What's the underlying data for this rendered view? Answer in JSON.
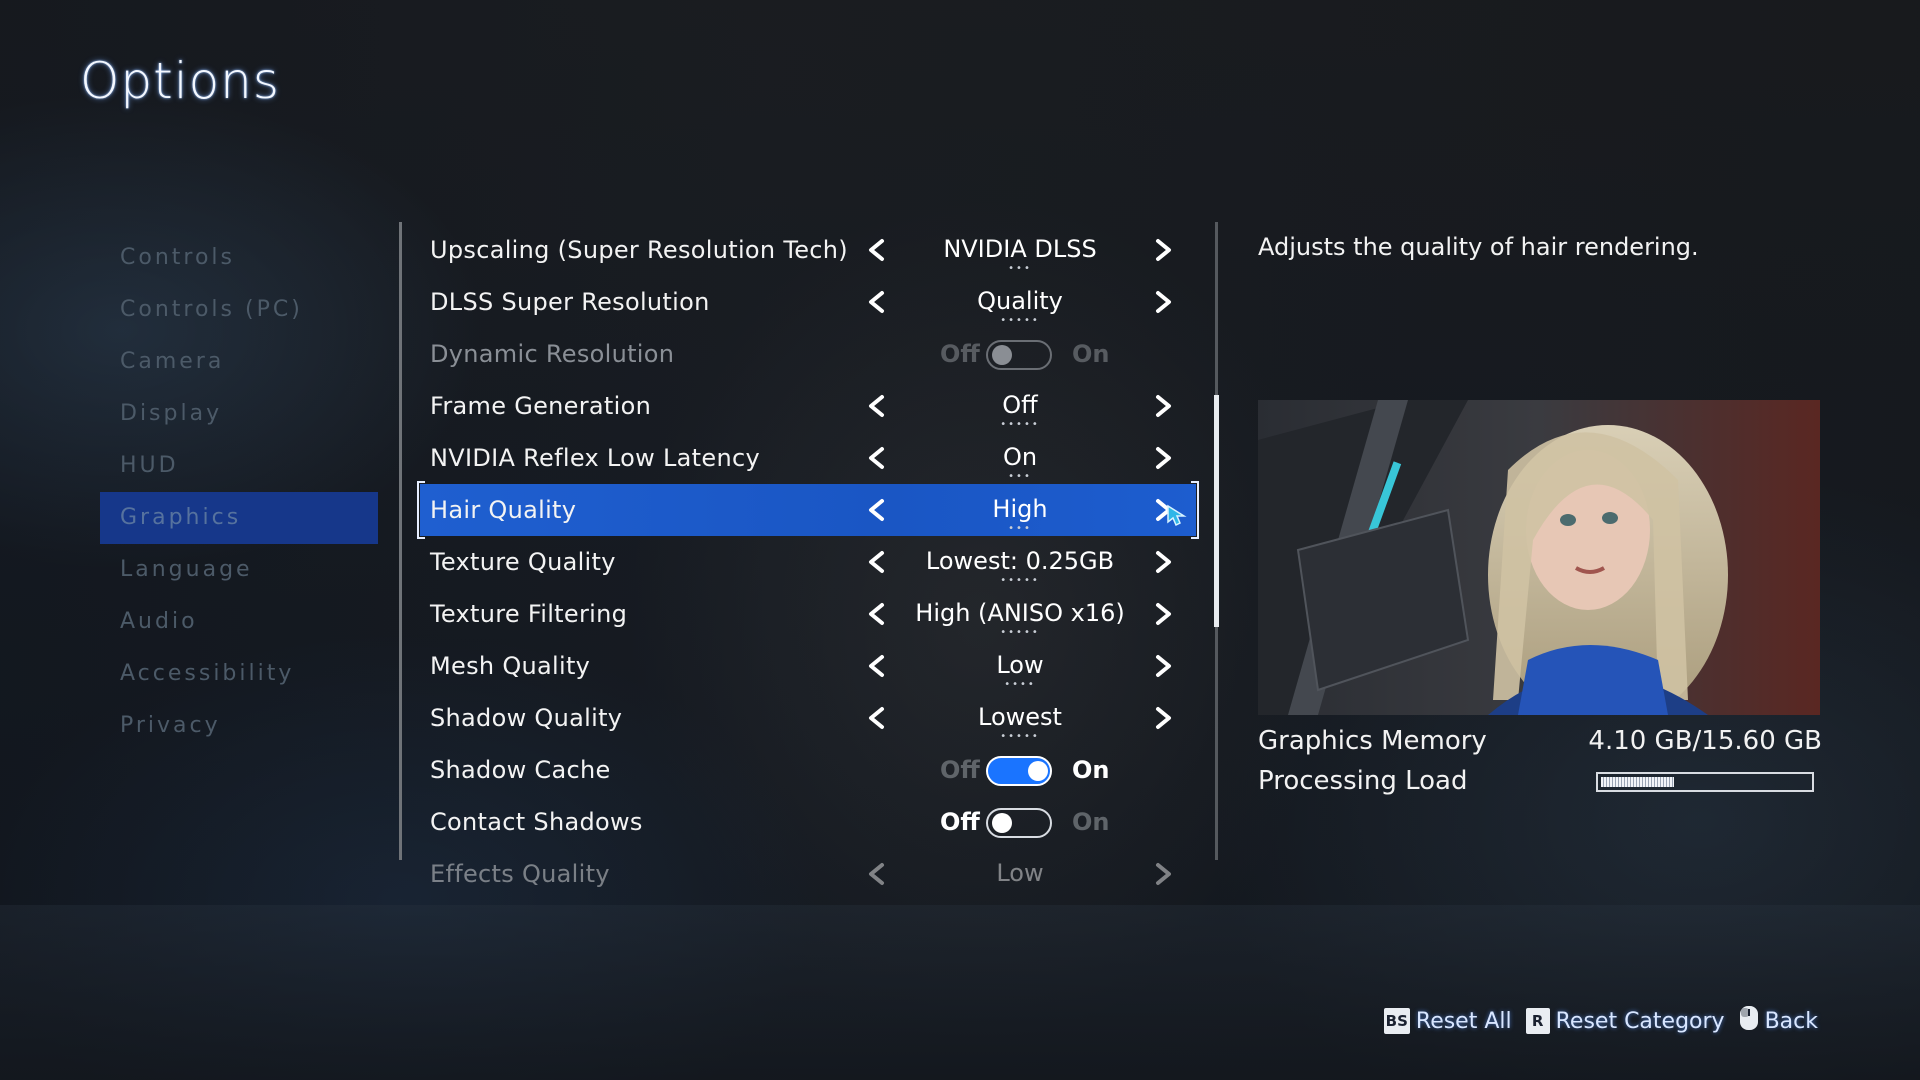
{
  "title": "Options",
  "categories": [
    {
      "label": "Controls"
    },
    {
      "label": "Controls (PC)"
    },
    {
      "label": "Camera"
    },
    {
      "label": "Display"
    },
    {
      "label": "HUD"
    },
    {
      "label": "Graphics",
      "active": true
    },
    {
      "label": "Language"
    },
    {
      "label": "Audio"
    },
    {
      "label": "Accessibility"
    },
    {
      "label": "Privacy"
    }
  ],
  "settings": [
    {
      "label": "Upscaling (Super Resolution Tech)",
      "type": "select",
      "value": "NVIDIA DLSS",
      "option_count": 3
    },
    {
      "label": "DLSS Super Resolution",
      "type": "select",
      "value": "Quality",
      "option_count": 5
    },
    {
      "label": "Dynamic Resolution",
      "type": "toggle",
      "off_label": "Off",
      "on_label": "On",
      "state": "off",
      "disabled": true
    },
    {
      "label": "Frame Generation",
      "type": "select",
      "value": "Off",
      "option_count": 5
    },
    {
      "label": "NVIDIA Reflex Low Latency",
      "type": "select",
      "value": "On",
      "option_count": 3
    },
    {
      "label": "Hair Quality",
      "type": "select",
      "value": "High",
      "option_count": 3,
      "selected": true
    },
    {
      "label": "Texture Quality",
      "type": "select",
      "value": "Lowest: 0.25GB",
      "option_count": 5
    },
    {
      "label": "Texture Filtering",
      "type": "select",
      "value": "High (ANISO x16)",
      "option_count": 5
    },
    {
      "label": "Mesh Quality",
      "type": "select",
      "value": "Low",
      "option_count": 4
    },
    {
      "label": "Shadow Quality",
      "type": "select",
      "value": "Lowest",
      "option_count": 5
    },
    {
      "label": "Shadow Cache",
      "type": "toggle",
      "off_label": "Off",
      "on_label": "On",
      "state": "on"
    },
    {
      "label": "Contact Shadows",
      "type": "toggle",
      "off_label": "Off",
      "on_label": "On",
      "state": "off"
    },
    {
      "label": "Effects Quality",
      "type": "select",
      "value": "Low",
      "faded": true
    }
  ],
  "info": {
    "description": "Adjusts the quality of hair rendering.",
    "graphics_memory_label": "Graphics Memory",
    "graphics_memory_value": "4.10 GB/15.60 GB",
    "processing_load_label": "Processing Load",
    "processing_load_fraction": 0.35
  },
  "footer": {
    "reset_all_key": "BS",
    "reset_all_label": "Reset All",
    "reset_category_key": "R",
    "reset_category_label": "Reset Category",
    "back_label": "Back"
  },
  "colors": {
    "accent": "#1a56c4",
    "toggle_on": "#1a74ff",
    "category_active_bg": "#16378a"
  }
}
